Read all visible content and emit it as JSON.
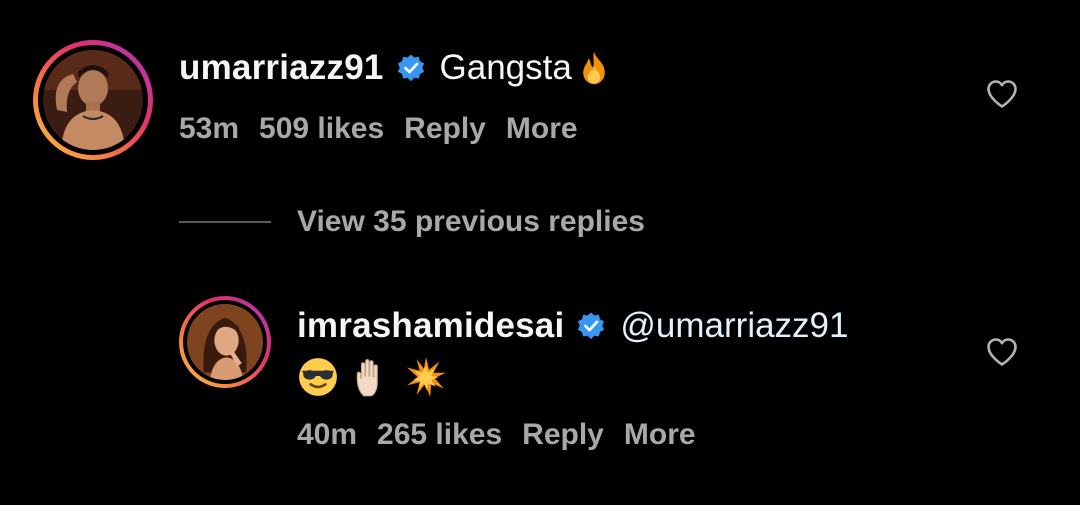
{
  "comments": [
    {
      "username": "umarriazz91",
      "verified": true,
      "text": "Gangsta",
      "text_emoji": "fire",
      "time": "53m",
      "likes": "509 likes",
      "reply_label": "Reply",
      "more_label": "More"
    },
    {
      "username": "imrashamidesai",
      "verified": true,
      "mention": "@umarriazz91",
      "emojis": [
        "smiling-face-with-sunglasses",
        "raised-hand",
        "collision"
      ],
      "time": "40m",
      "likes": "265 likes",
      "reply_label": "Reply",
      "more_label": "More"
    }
  ],
  "view_replies": {
    "label": "View 35 previous replies"
  },
  "colors": {
    "background": "#000000",
    "text_primary": "#f5f5f5",
    "text_secondary": "#a8a8a8",
    "verified_blue": "#3897f0",
    "mention_color": "#e0f1ff"
  }
}
